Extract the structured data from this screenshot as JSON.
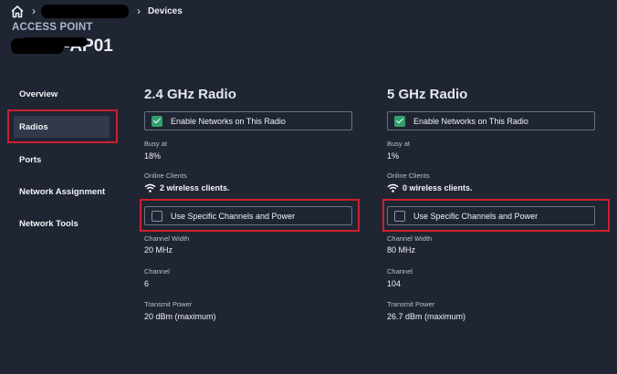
{
  "breadcrumb": {
    "current": "Devices"
  },
  "header": {
    "eyebrow": "ACCESS POINT",
    "title_visible": "-AP01"
  },
  "nav": {
    "items": [
      "Overview",
      "Radios",
      "Ports",
      "Network Assignment",
      "Network Tools"
    ],
    "active": "Radios"
  },
  "radios": [
    {
      "title": "2.4 GHz Radio",
      "enable_label": "Enable Networks on This Radio",
      "enabled": true,
      "busy_label": "Busy at",
      "busy_value": "18%",
      "online_label": "Online Clients",
      "online_value": "2 wireless clients.",
      "specific_label": "Use Specific Channels and Power",
      "specific_checked": false,
      "width_label": "Channel Width",
      "width_value": "20 MHz",
      "channel_label": "Channel",
      "channel_value": "6",
      "power_label": "Transmit Power",
      "power_value": "20 dBm (maximum)"
    },
    {
      "title": "5 GHz Radio",
      "enable_label": "Enable Networks on This Radio",
      "enabled": true,
      "busy_label": "Busy at",
      "busy_value": "1%",
      "online_label": "Online Clients",
      "online_value": "0 wireless clients.",
      "specific_label": "Use Specific Channels and Power",
      "specific_checked": false,
      "width_label": "Channel Width",
      "width_value": "80 MHz",
      "channel_label": "Channel",
      "channel_value": "104",
      "power_label": "Transmit Power",
      "power_value": "26.7 dBm (maximum)"
    }
  ],
  "colors": {
    "background": "#1f2533",
    "highlight": "#cf1f2e",
    "checkbox_on": "#33a06b"
  },
  "icons": [
    "home-icon",
    "chevron-right-icon",
    "checkbox-checked-icon",
    "checkbox-empty-icon",
    "wifi-icon"
  ]
}
